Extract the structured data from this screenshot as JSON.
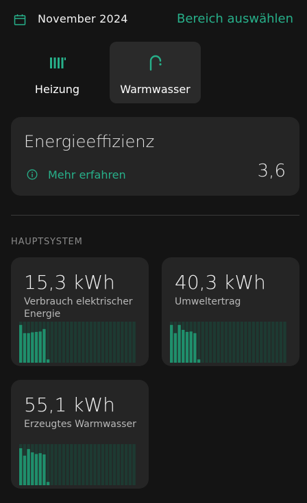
{
  "header": {
    "month": "November 2024",
    "range_button": "Bereich auswählen",
    "icon": "calendar-icon"
  },
  "tabs": [
    {
      "label": "Heizung",
      "icon": "radiator-icon",
      "selected": false
    },
    {
      "label": "Warmwasser",
      "icon": "faucet-icon",
      "selected": true
    }
  ],
  "efficiency": {
    "title": "Energieeffizienz",
    "more_link": "Mehr erfahren",
    "value": "3,6"
  },
  "section": {
    "title": "HAUPTSYSTEM"
  },
  "tiles": [
    {
      "value": "15,3 kWh",
      "label": "Verbrauch elektrischer Energie",
      "bars": [
        0.92,
        0.72,
        0.72,
        0.74,
        0.75,
        0.76,
        0.82,
        0.08,
        0,
        0,
        0,
        0,
        0,
        0,
        0,
        0,
        0,
        0,
        0,
        0,
        0,
        0,
        0,
        0,
        0,
        0,
        0,
        0,
        0,
        0
      ]
    },
    {
      "value": "40,3 kWh",
      "label": "Umweltertrag",
      "bars": [
        0.92,
        0.72,
        0.92,
        0.8,
        0.75,
        0.76,
        0.72,
        0.08,
        0,
        0,
        0,
        0,
        0,
        0,
        0,
        0,
        0,
        0,
        0,
        0,
        0,
        0,
        0,
        0,
        0,
        0,
        0,
        0,
        0,
        0
      ]
    },
    {
      "value": "55,1 kWh",
      "label": "Erzeugtes Warmwasser",
      "bars": [
        0.9,
        0.72,
        0.88,
        0.8,
        0.76,
        0.78,
        0.75,
        0.08,
        0,
        0,
        0,
        0,
        0,
        0,
        0,
        0,
        0,
        0,
        0,
        0,
        0,
        0,
        0,
        0,
        0,
        0,
        0,
        0,
        0,
        0
      ]
    }
  ],
  "colors": {
    "accent": "#27b08a",
    "bar_active": "#1f8f6c",
    "bar_inactive": "#1d3a32"
  }
}
